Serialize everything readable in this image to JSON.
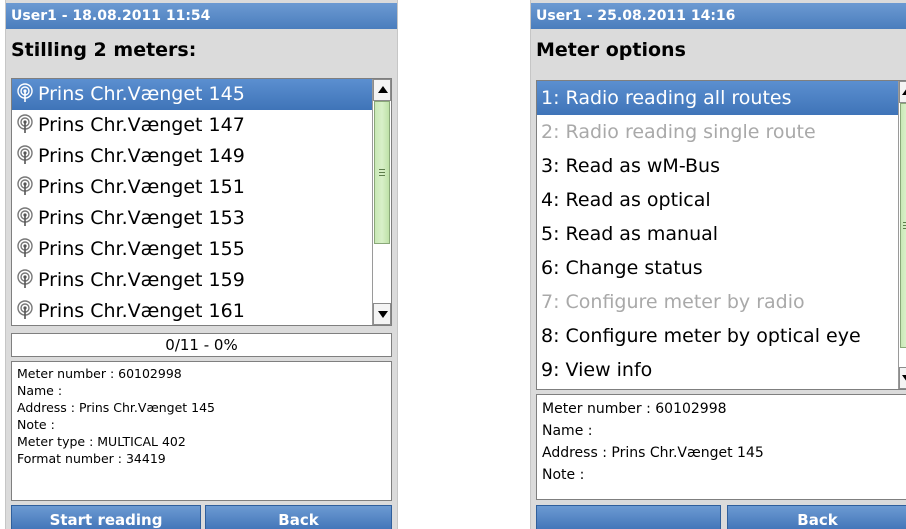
{
  "screen1": {
    "title": "User1 - 18.08.2011 11:54",
    "heading": "Stilling 2 meters:",
    "list_items": [
      {
        "label": "Prins Chr.Vænget 145",
        "icon": "radio-antenna-icon",
        "selected": true
      },
      {
        "label": "Prins Chr.Vænget 147",
        "icon": "radio-antenna-icon"
      },
      {
        "label": "Prins Chr.Vænget 149",
        "icon": "radio-antenna-icon"
      },
      {
        "label": "Prins Chr.Vænget 151",
        "icon": "radio-antenna-icon"
      },
      {
        "label": "Prins Chr.Vænget 153",
        "icon": "radio-antenna-icon"
      },
      {
        "label": "Prins Chr.Vænget 155",
        "icon": "radio-antenna-icon"
      },
      {
        "label": "Prins Chr.Vænget 159",
        "icon": "radio-antenna-icon"
      },
      {
        "label": "Prins Chr.Vænget 161",
        "icon": "radio-antenna-icon"
      }
    ],
    "progress": "0/11 - 0%",
    "info": [
      "Meter number : 60102998",
      "Name :",
      "Address : Prins Chr.Vænget 145",
      "Note :",
      "Meter type : MULTICAL 402",
      "Format number : 34419"
    ],
    "buttons": {
      "start": "Start reading",
      "back": "Back"
    }
  },
  "screen2": {
    "title": "User1 - 25.08.2011 14:16",
    "heading": "Meter options",
    "options": [
      {
        "label": "1: Radio reading all routes",
        "selected": true
      },
      {
        "label": "2: Radio reading single route",
        "disabled": true
      },
      {
        "label": "3: Read as wM-Bus"
      },
      {
        "label": "4: Read as optical"
      },
      {
        "label": "5: Read as manual"
      },
      {
        "label": "6: Change status"
      },
      {
        "label": "7: Configure meter by radio",
        "disabled": true
      },
      {
        "label": "8: Configure meter by optical eye"
      },
      {
        "label": "9: View info"
      }
    ],
    "info": [
      "Meter number : 60102998",
      "Name :",
      "Address : Prins Chr.Vænget 145",
      "Note :"
    ],
    "buttons": {
      "left": "",
      "back": "Back"
    }
  },
  "colors": {
    "titlebar": "#4a7dbd",
    "selection": "#3f74b8",
    "disabled_text": "#a9a9a9",
    "scroll_thumb": "#c9e8b6"
  }
}
